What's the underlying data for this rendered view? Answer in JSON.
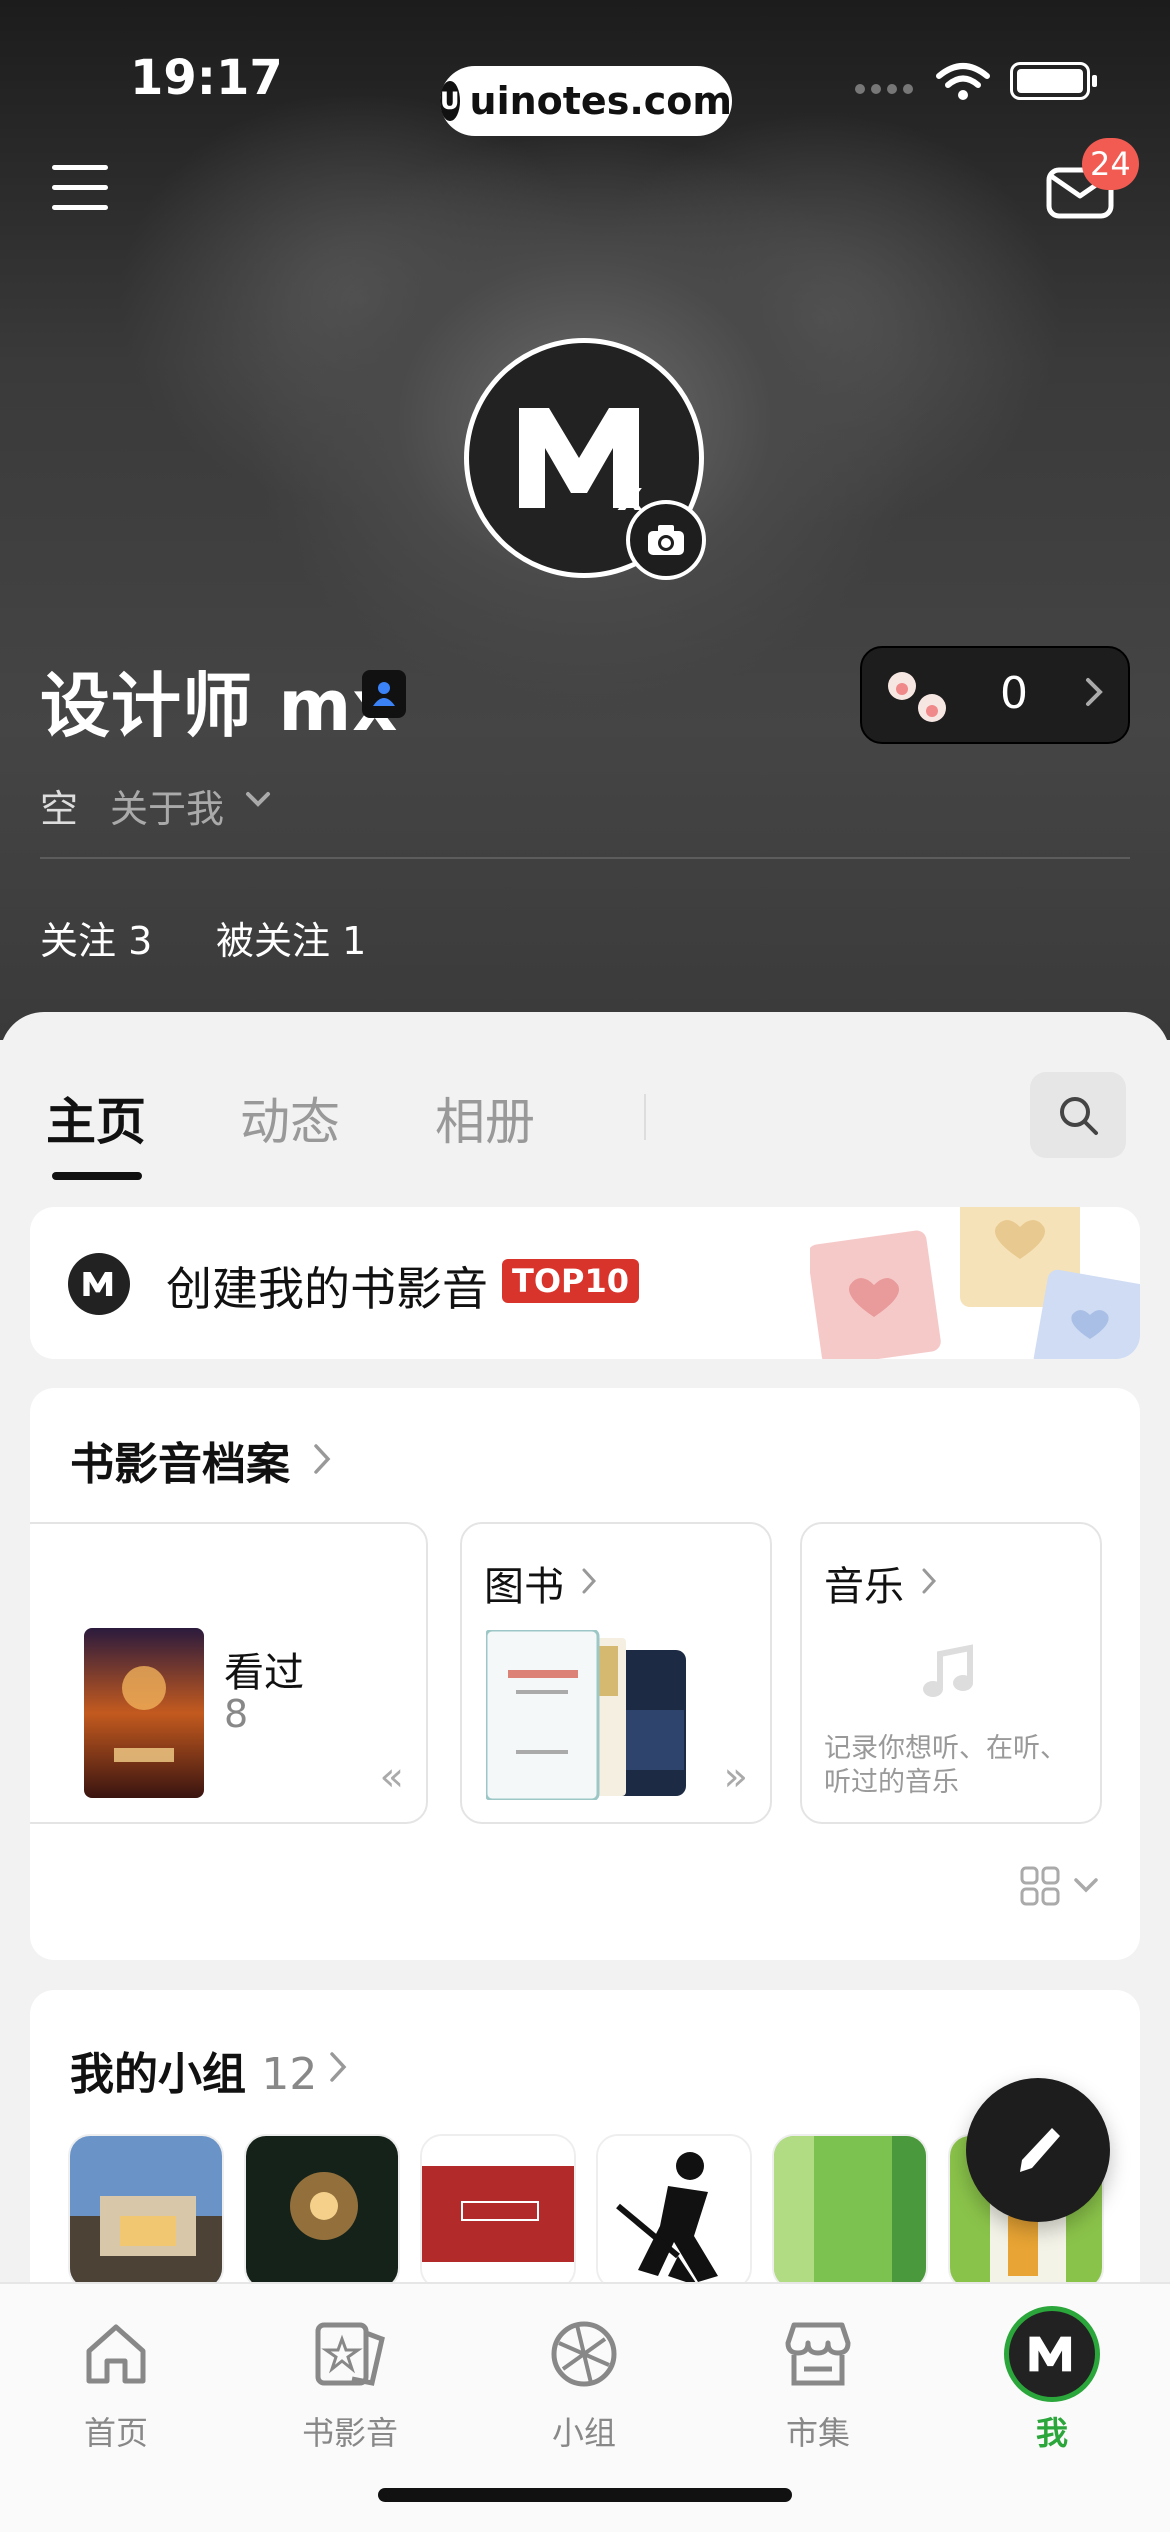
{
  "status_bar": {
    "time": "19:17",
    "url": "uinotes.com"
  },
  "header": {
    "mail_badge": "24"
  },
  "profile": {
    "name": "设计师 mx",
    "coins": "0",
    "bio": "空",
    "about_label": "关于我",
    "following": "关注 3",
    "followers": "被关注 1"
  },
  "tabs": [
    "主页",
    "动态",
    "相册"
  ],
  "create_card": {
    "text": "创建我的书影音",
    "badge": "TOP10"
  },
  "archive": {
    "title": "书影音档案",
    "movie": {
      "label": "看过",
      "count": "8"
    },
    "books": {
      "label": "图书"
    },
    "music": {
      "label": "音乐",
      "hint": "记录你想听、在听、听过的音乐"
    }
  },
  "groups": {
    "title": "我的小组",
    "count": "12"
  },
  "bottom_nav": [
    {
      "label": "首页",
      "icon": "home-icon"
    },
    {
      "label": "书影音",
      "icon": "book-movie-music-icon"
    },
    {
      "label": "小组",
      "icon": "group-icon"
    },
    {
      "label": "市集",
      "icon": "market-icon"
    },
    {
      "label": "我",
      "icon": "me-avatar-icon"
    }
  ],
  "colors": {
    "accent_green": "#2aa63a",
    "badge_red": "#f15b52",
    "top10_red": "#d8342b"
  }
}
